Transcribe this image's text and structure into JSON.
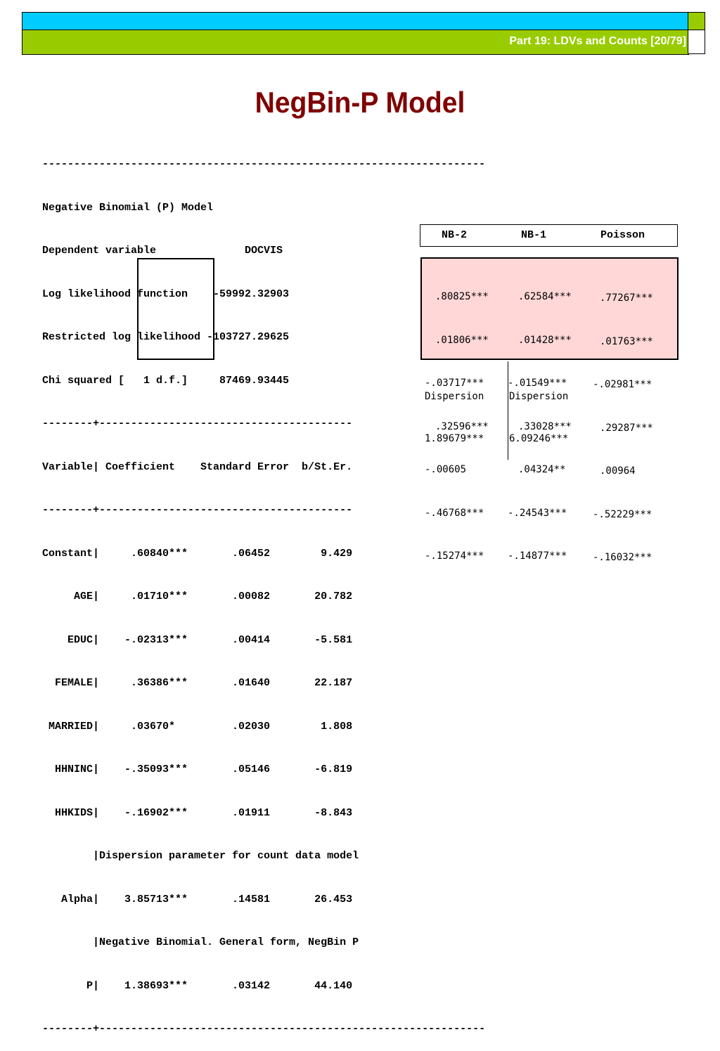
{
  "header": {
    "text": "Part 19: LDVs and Counts [20/79]"
  },
  "title": "NegBin-P Model",
  "output_lines": [
    "----------------------------------------------------------------------",
    "Negative Binomial (P) Model",
    "Dependent variable              DOCVIS",
    "Log likelihood function    -59992.32903",
    "Restricted log likelihood -103727.29625",
    "Chi squared [   1 d.f.]     87469.93445",
    "--------+----------------------------------------",
    "Variable| Coefficient    Standard Error  b/St.Er.",
    "--------+----------------------------------------",
    "Constant|     .60840***       .06452        9.429",
    "     AGE|     .01710***       .00082       20.782",
    "    EDUC|    -.02313***       .00414       -5.581",
    "  FEMALE|     .36386***       .01640       22.187",
    " MARRIED|     .03670*         .02030        1.808",
    "  HHNINC|    -.35093***       .05146       -6.819",
    "  HHKIDS|    -.16902***       .01911       -8.843",
    "        |Dispersion parameter for count data model",
    "   Alpha|    3.85713***       .14581       26.453",
    "        |Negative Binomial. General form, NegBin P",
    "       P|    1.38693***       .03142       44.140",
    "--------+-------------------------------------------------------------"
  ],
  "comparison": {
    "headers": [
      "NB-2",
      "NB-1",
      "Poisson"
    ],
    "nb2": [
      ".80825***",
      ".01806***",
      "-.03717***",
      ".32596***",
      "-.00605",
      "-.46768***",
      "-.15274***"
    ],
    "nb1": [
      ".62584***",
      ".01428***",
      "-.01549***",
      ".33028***",
      ".04324**",
      "-.24543***",
      "-.14877***"
    ],
    "poisson": [
      ".77267***",
      ".01763***",
      "-.02981***",
      ".29287***",
      ".00964",
      "-.52229***",
      "-.16032***"
    ],
    "dispersion_label_nb2": "Dispersion",
    "dispersion_label_nb1": "Dispersion",
    "dispersion_nb2": "1.89679***",
    "dispersion_nb1": "6.09246***"
  }
}
